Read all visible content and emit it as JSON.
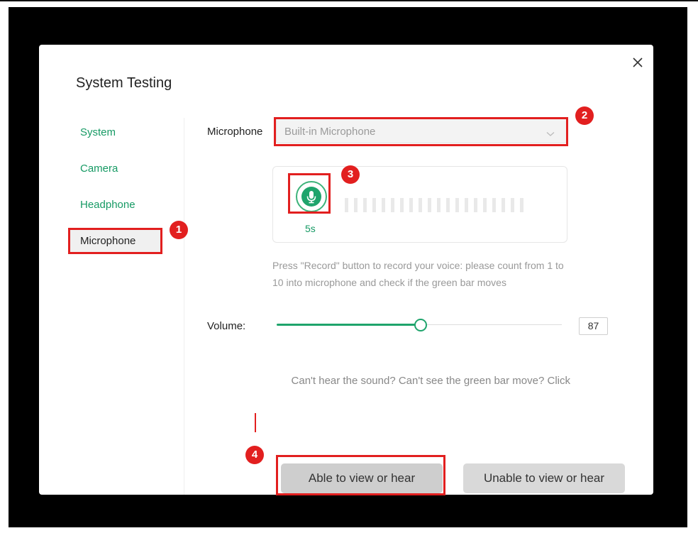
{
  "dialog": {
    "title": "System Testing",
    "close_icon": "close-icon"
  },
  "sidebar": {
    "items": [
      {
        "label": "System",
        "active": false
      },
      {
        "label": "Camera",
        "active": false
      },
      {
        "label": "Headphone",
        "active": false
      },
      {
        "label": "Microphone",
        "active": true
      }
    ]
  },
  "microphone": {
    "label": "Microphone",
    "selected": "Built-in Microphone",
    "dropdown_icon": "chevron-down-icon"
  },
  "recorder": {
    "button_icon": "microphone-icon",
    "timer": "5s",
    "level_bar_count": 20,
    "level_active": 0
  },
  "instructions": "Press \"Record\" button to record your voice: please count from 1 to 10 into microphone and check if the green bar moves",
  "volume": {
    "label": "Volume:",
    "value": 87,
    "value_text": "87"
  },
  "help_text": "Can't hear the sound? Can't see the green bar move? Click",
  "buttons": {
    "able": "Able to view or hear",
    "unable": "Unable to view or hear"
  },
  "annotations": [
    "1",
    "2",
    "3",
    "4"
  ],
  "colors": {
    "accent_green": "#1fa46c",
    "annotation_red": "#e21f1f"
  }
}
